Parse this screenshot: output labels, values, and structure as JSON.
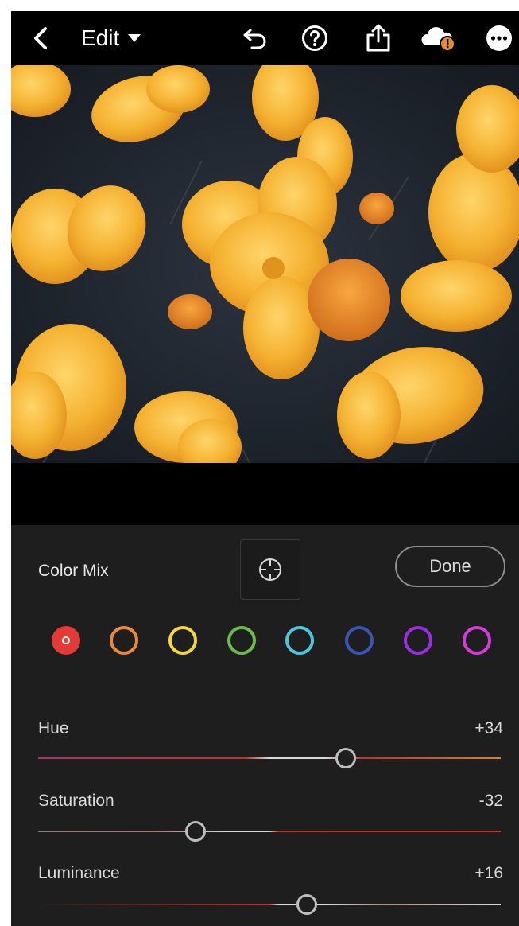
{
  "topbar": {
    "edit_label": "Edit",
    "icons": [
      "back-chevron-icon",
      "dropdown-caret-icon",
      "undo-icon",
      "help-icon",
      "share-icon",
      "cloud-warning-icon",
      "more-icon"
    ]
  },
  "panel": {
    "title": "Color Mix",
    "done_label": "Done",
    "swatch_colors": [
      "#e13a37",
      "#e8893b",
      "#f2d641",
      "#6cbb4d",
      "#4ec5dd",
      "#3b55b4",
      "#9a2ee0",
      "#d63bd9"
    ],
    "sliders": [
      {
        "name": "hue",
        "label": "Hue",
        "value": "+34",
        "level": 0.665
      },
      {
        "name": "saturation",
        "label": "Saturation",
        "value": "-32",
        "level": 0.34
      },
      {
        "name": "luminance",
        "label": "Luminance",
        "value": "+16",
        "level": 0.58
      }
    ]
  },
  "colors": {
    "accent_red": "#e13a37",
    "panel_bg": "#1e1e1e",
    "text": "#d8d8d8"
  }
}
